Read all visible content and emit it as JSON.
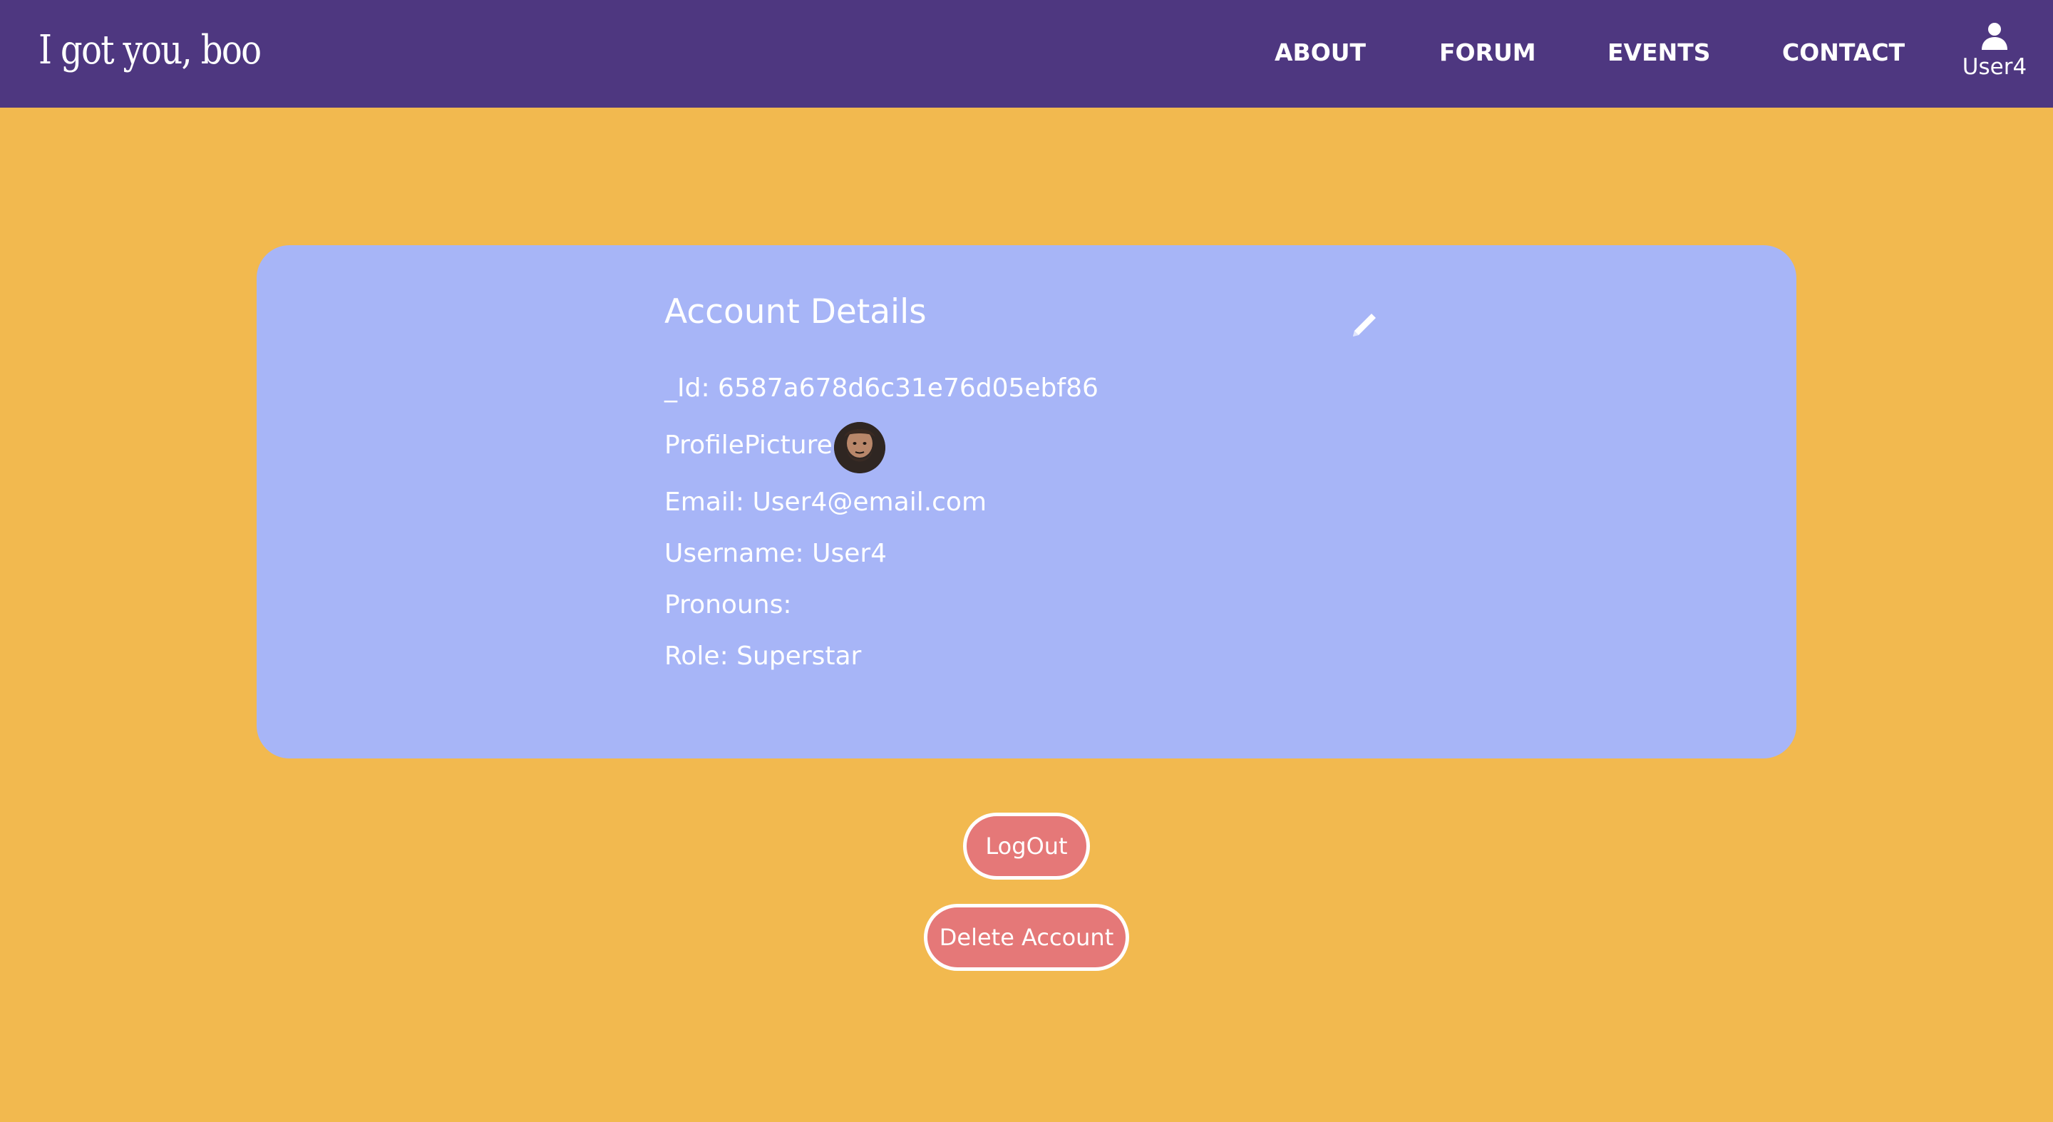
{
  "header": {
    "logo_text": "I got you, boo",
    "nav": [
      {
        "label": "ABOUT"
      },
      {
        "label": "FORUM"
      },
      {
        "label": "EVENTS"
      },
      {
        "label": "CONTACT"
      }
    ],
    "user_label": "User4",
    "user_icon": "person-icon"
  },
  "account": {
    "title": "Account Details",
    "edit_icon": "pencil-icon",
    "id_line": "_Id: 6587a678d6c31e76d05ebf86",
    "profile_picture_label": "ProfilePicture:",
    "email_line": "Email: User4@email.com",
    "username_line": "Username: User4",
    "pronouns_line": "Pronouns:",
    "role_line": "Role: Superstar"
  },
  "actions": {
    "logout_label": "LogOut",
    "delete_label": "Delete Account"
  },
  "colors": {
    "navbar": "#4E3780",
    "background": "#F2B94F",
    "card": "#A7B5F7",
    "button": "#E57878",
    "text": "#FFFFFF"
  }
}
